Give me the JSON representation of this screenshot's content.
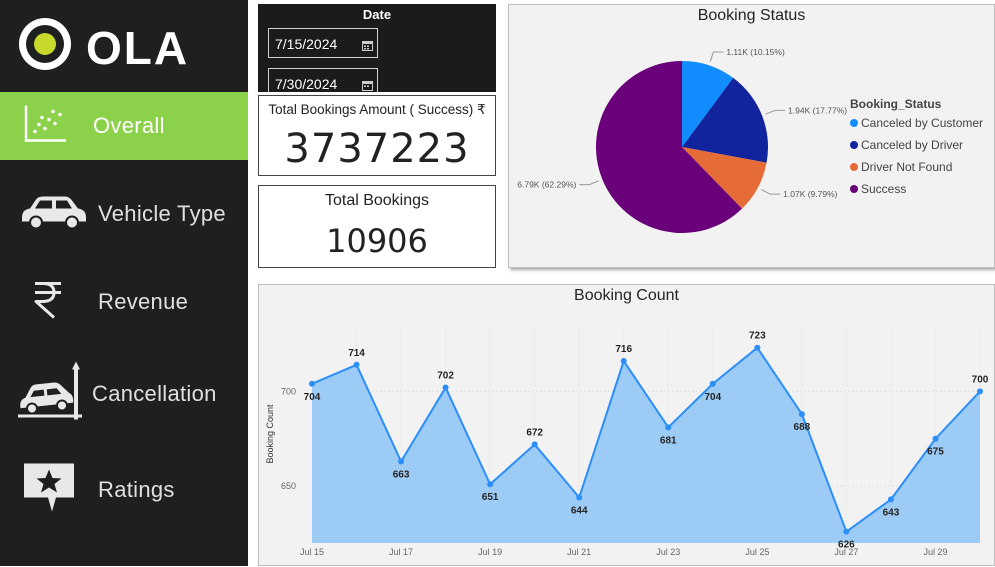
{
  "brand": {
    "name": "OLA"
  },
  "nav": {
    "items": [
      {
        "label": "Overall",
        "icon": "scatter-chart-icon",
        "active": true
      },
      {
        "label": "Vehicle Type",
        "icon": "car-icon",
        "active": false
      },
      {
        "label": "Revenue",
        "icon": "rupee-icon",
        "active": false
      },
      {
        "label": "Cancellation",
        "icon": "car-crash-icon",
        "active": false
      },
      {
        "label": "Ratings",
        "icon": "star-message-icon",
        "active": false
      }
    ]
  },
  "filters": {
    "date": {
      "title": "Date",
      "start": "7/15/2024",
      "end": "7/30/2024",
      "icon": "calendar-icon"
    }
  },
  "kpis": {
    "amount": {
      "title": "Total Bookings Amount ( Success) ₹",
      "value": "3737223"
    },
    "bookings": {
      "title": "Total Bookings",
      "value": "10906"
    }
  },
  "colors": {
    "accent": "#8bd14a",
    "sidebar": "#1f1f1f",
    "line": "#2c8ef8",
    "area": "#9ccbf6"
  },
  "chart_data": [
    {
      "type": "pie",
      "title": "Booking Status",
      "legend_title": "Booking_Status",
      "legend_position": "right",
      "slices": [
        {
          "name": "Canceled by Customer",
          "value": 1107,
          "label": "1.11K (10.15%)",
          "color": "#118dff"
        },
        {
          "name": "Canceled by Driver",
          "value": 1938,
          "label": "1.94K (17.77%)",
          "color": "#12239e"
        },
        {
          "name": "Driver Not Found",
          "value": 1068,
          "label": "1.07K (9.79%)",
          "color": "#e66c37"
        },
        {
          "name": "Success",
          "value": 6793,
          "label": "6.79K (62.29%)",
          "color": "#6b007b"
        }
      ]
    },
    {
      "type": "area",
      "title": "Booking Count",
      "xlabel": "",
      "ylabel": "Booking Count",
      "x": [
        "Jul 15",
        "Jul 16",
        "Jul 17",
        "Jul 18",
        "Jul 19",
        "Jul 20",
        "Jul 21",
        "Jul 22",
        "Jul 23",
        "Jul 24",
        "Jul 25",
        "Jul 26",
        "Jul 27",
        "Jul 28",
        "Jul 29",
        "Jul 30"
      ],
      "x_ticks": [
        "Jul 15",
        "Jul 17",
        "Jul 19",
        "Jul 21",
        "Jul 23",
        "Jul 25",
        "Jul 27",
        "Jul 29"
      ],
      "y_ticks": [
        650,
        700
      ],
      "values": [
        704,
        714,
        663,
        702,
        651,
        672,
        644,
        716,
        681,
        704,
        723,
        688,
        626,
        643,
        675,
        700
      ],
      "ylim": [
        620,
        735
      ],
      "grid": true
    }
  ]
}
